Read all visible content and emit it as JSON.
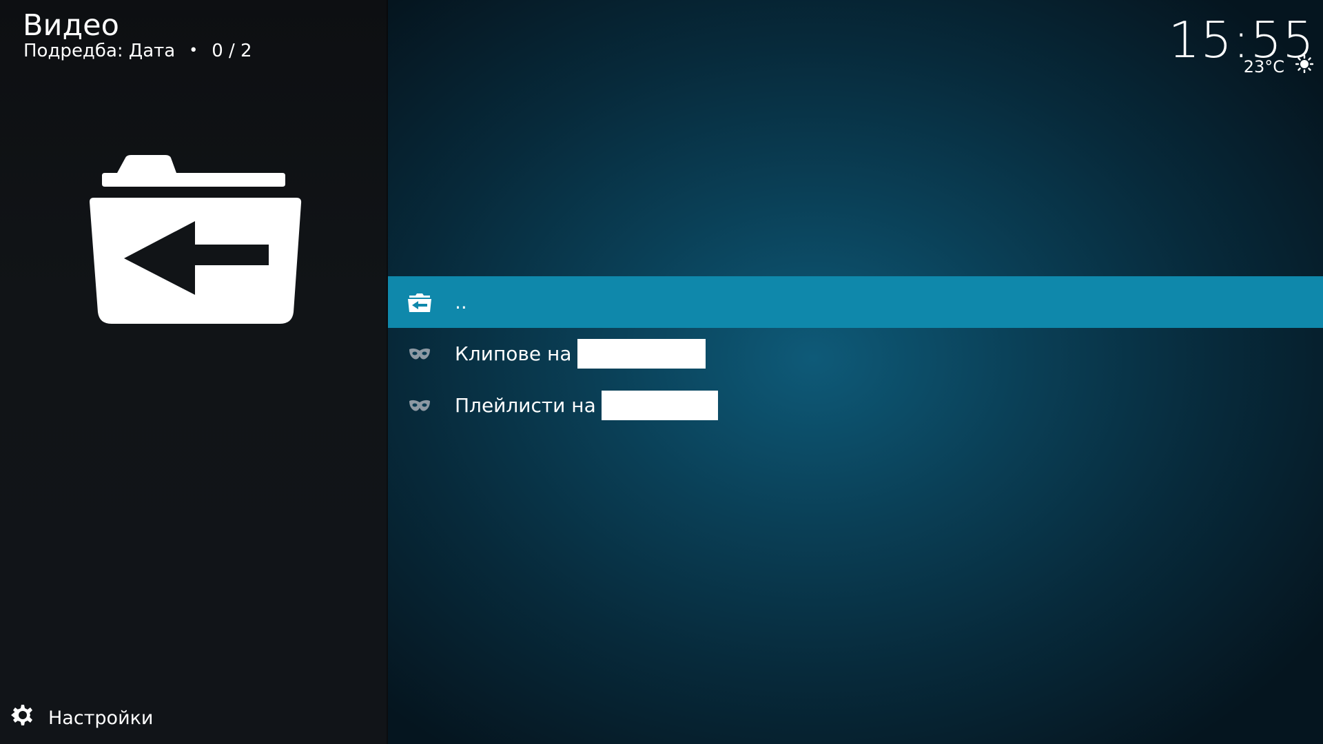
{
  "header": {
    "title": "Видео",
    "sort_label": "Подредба: Дата",
    "separator": "•",
    "count": "0 / 2"
  },
  "status": {
    "time": "15:55",
    "temperature": "23°C",
    "weather_icon": "sun-icon"
  },
  "preview": {
    "icon": "folder-back-icon"
  },
  "list": {
    "items": [
      {
        "label": "..",
        "icon": "folder-back-icon",
        "selected": true
      },
      {
        "label": "Клипове на",
        "icon": "mask-icon",
        "selected": false
      },
      {
        "label": "Плейлисти на",
        "icon": "mask-icon",
        "selected": false
      }
    ]
  },
  "footer": {
    "settings_label": "Настройки",
    "settings_icon": "settings-icon"
  },
  "colors": {
    "accent": "#0f88ab",
    "sidebar_bg": "#111417",
    "background": "#0a3f56"
  }
}
